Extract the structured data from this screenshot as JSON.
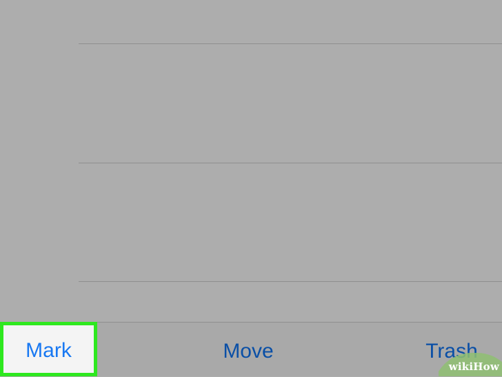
{
  "toolbar": {
    "mark_label": "Mark",
    "move_label": "Move",
    "trash_label": "Trash"
  },
  "watermark": {
    "text": "wikiHow"
  },
  "colors": {
    "background": "#adadad",
    "separator": "#8e8e8e",
    "button_text": "#0a4fa6",
    "highlight_border": "#2ee81f",
    "highlight_text": "#1878f2"
  }
}
